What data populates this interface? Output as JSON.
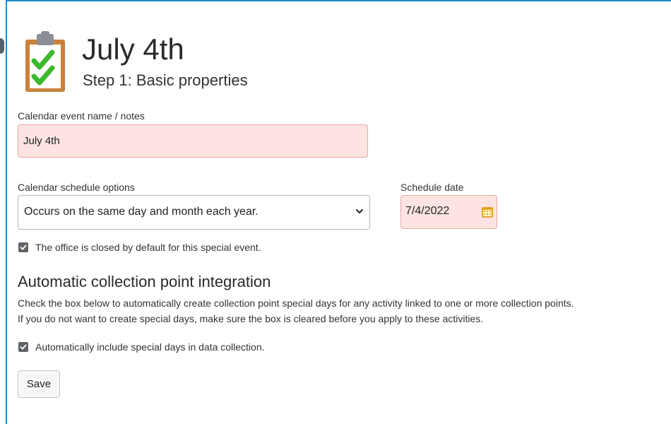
{
  "page": {
    "title": "July 4th",
    "subtitle": "Step 1: Basic properties",
    "header_icon": "clipboard-check-icon"
  },
  "event_name": {
    "label": "Calendar event name / notes",
    "value": "July 4th"
  },
  "schedule_options": {
    "label": "Calendar schedule options",
    "selected": "Occurs on the same day and month each year."
  },
  "schedule_date": {
    "label": "Schedule date",
    "value": "7/4/2022"
  },
  "office_closed": {
    "label": "The office is closed by default for this special event.",
    "checked": true
  },
  "collection": {
    "heading": "Automatic collection point integration",
    "description_line1": "Check the box below to automatically create collection point special days for any activity linked to one or more collection points.",
    "description_line2": "If you do not want to create special days, make sure the box is cleared before you apply to these activities.",
    "include_label": "Automatically include special days in data collection.",
    "include_checked": true
  },
  "actions": {
    "save_label": "Save"
  },
  "colors": {
    "frame_border": "#1e8bc3",
    "required_field_bg": "#fde4e2",
    "required_field_border": "#e8a7a3",
    "clipboard_brown": "#c9823b",
    "check_green": "#3db82e",
    "calendar_icon": "#e8a030"
  }
}
